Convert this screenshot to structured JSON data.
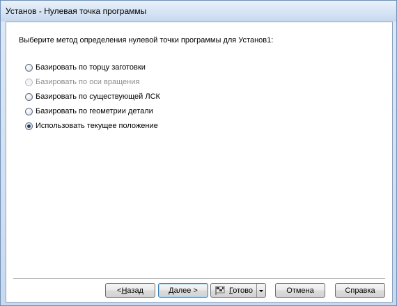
{
  "window": {
    "title": "Установ - Нулевая точка программы"
  },
  "prompt": "Выберите метод определения нулевой точки программы для Установ1:",
  "options": [
    {
      "label": "Базировать по торцу заготовки",
      "selected": false,
      "enabled": true
    },
    {
      "label": "Базировать по оси вращения",
      "selected": false,
      "enabled": false
    },
    {
      "label": "Базировать по существующей ЛСК",
      "selected": false,
      "enabled": true
    },
    {
      "label": "Базировать по геометрии детали",
      "selected": false,
      "enabled": true
    },
    {
      "label": "Использовать текущее положение",
      "selected": true,
      "enabled": true
    }
  ],
  "buttons": {
    "back_prefix": "< ",
    "back_hotkey": "Н",
    "back_rest": "азад",
    "next_hotkey": "Д",
    "next_rest": "алее >",
    "finish_hotkey": "Г",
    "finish_rest": "отово",
    "cancel": "Отмена",
    "help": "Справка"
  },
  "icons": {
    "finish": "finish-flag-icon",
    "dropdown": "chevron-down-icon"
  },
  "colors": {
    "title_bar": "#d8e5f5",
    "radio_dot": "#1f3a5f",
    "disabled_text": "#8d8d8d",
    "default_button_border": "#3c7fb1"
  }
}
